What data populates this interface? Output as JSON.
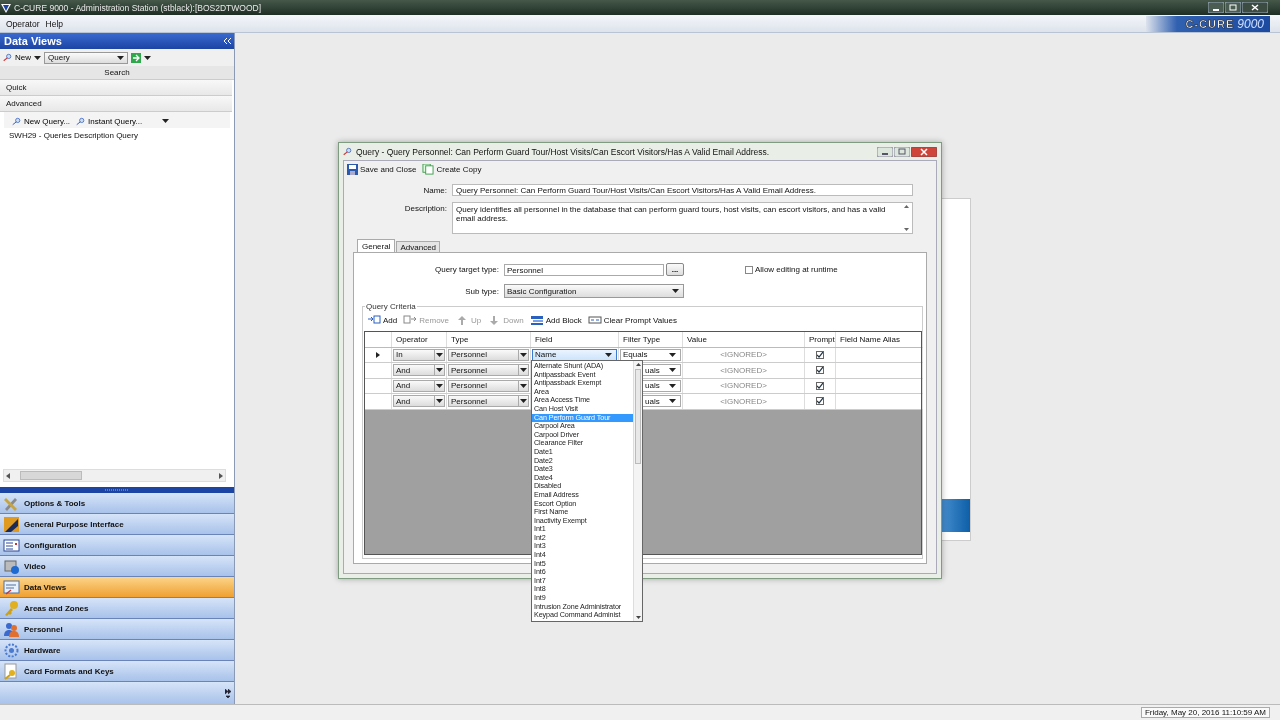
{
  "app_window": {
    "title": "C-CURE 9000 - Administration Station (stblack):[BOS2DTWOOD]",
    "menu": [
      "Operator",
      "Help"
    ],
    "logo": {
      "brand": "C-CURE",
      "version": "9000"
    }
  },
  "sidebar": {
    "title": "Data Views",
    "new_label": "New",
    "view_select": "Query",
    "search_header": "Search",
    "sections": [
      "Quick",
      "Advanced"
    ],
    "list_toolbar": [
      "New Query...",
      "Instant Query..."
    ],
    "items": [
      "SWH29 - Queries Description Query"
    ],
    "nav": [
      {
        "label": "Options & Tools",
        "selected": false
      },
      {
        "label": "General Purpose Interface",
        "selected": false
      },
      {
        "label": "Configuration",
        "selected": false
      },
      {
        "label": "Video",
        "selected": false
      },
      {
        "label": "Data Views",
        "selected": true
      },
      {
        "label": "Areas and Zones",
        "selected": false
      },
      {
        "label": "Personnel",
        "selected": false
      },
      {
        "label": "Hardware",
        "selected": false
      },
      {
        "label": "Card Formats and Keys",
        "selected": false
      }
    ]
  },
  "dialog": {
    "title": "Query  -  Query Personnel: Can Perform Guard Tour/Host Visits/Can Escort Visitors/Has A Valid Email Address.",
    "toolbar": [
      "Save and Close",
      "Create Copy"
    ],
    "name": {
      "label": "Name:",
      "value": "Query Personnel: Can Perform Guard Tour/Host Visits/Can Escort Visitors/Has A Valid Email Address."
    },
    "description": {
      "label": "Description:",
      "value": "Query identifies all personnel in the database that can perform guard tours, host visits, can escort visitors, and has a valid email address."
    },
    "tabs": [
      {
        "label": "General",
        "selected": true
      },
      {
        "label": "Advanced",
        "selected": false
      }
    ],
    "target_type": {
      "label": "Query target type:",
      "value": "Personnel",
      "button": "..."
    },
    "allow_editing": {
      "label": "Allow editing at runtime",
      "checked": false
    },
    "sub_type": {
      "label": "Sub type:",
      "value": "Basic Configuration"
    },
    "criteria": {
      "title": "Query Criteria",
      "toolbar": [
        {
          "label": "Add",
          "disabled": false
        },
        {
          "label": "Remove",
          "disabled": true
        },
        {
          "label": "Up",
          "disabled": true
        },
        {
          "label": "Down",
          "disabled": true
        },
        {
          "label": "Add Block",
          "disabled": false
        },
        {
          "label": "Clear Prompt Values",
          "disabled": false
        }
      ],
      "columns": [
        "Operator",
        "Type",
        "Field",
        "Filter Type",
        "Value",
        "Prompt",
        "Field Name Alias"
      ],
      "rows": [
        {
          "current": true,
          "operator": "In",
          "type": "Personnel",
          "field": "Name",
          "filter_type": "Equals",
          "value": "<IGNORED>",
          "prompt": true
        },
        {
          "current": false,
          "operator": "And",
          "type": "Personnel",
          "filter_type": "uals",
          "value": "<IGNORED>",
          "prompt": true
        },
        {
          "current": false,
          "operator": "And",
          "type": "Personnel",
          "filter_type": "uals",
          "value": "<IGNORED>",
          "prompt": true
        },
        {
          "current": false,
          "operator": "And",
          "type": "Personnel",
          "filter_type": "uals",
          "value": "<IGNORED>",
          "prompt": true
        }
      ],
      "field_dropdown": [
        {
          "label": "Alternate Shunt (ADA)",
          "selected": false
        },
        {
          "label": "Antipassback Event",
          "selected": false
        },
        {
          "label": "Antipassback Exempt",
          "selected": false
        },
        {
          "label": "Area",
          "selected": false
        },
        {
          "label": "Area Access Time",
          "selected": false
        },
        {
          "label": "Can Host Visit",
          "selected": false
        },
        {
          "label": "Can Perform Guard Tour",
          "selected": true
        },
        {
          "label": "Carpool Area",
          "selected": false
        },
        {
          "label": "Carpool Driver",
          "selected": false
        },
        {
          "label": "Clearance Filter",
          "selected": false
        },
        {
          "label": "Date1",
          "selected": false
        },
        {
          "label": "Date2",
          "selected": false
        },
        {
          "label": "Date3",
          "selected": false
        },
        {
          "label": "Date4",
          "selected": false
        },
        {
          "label": "Disabled",
          "selected": false
        },
        {
          "label": "Email Address",
          "selected": false
        },
        {
          "label": "Escort Option",
          "selected": false
        },
        {
          "label": "First Name",
          "selected": false
        },
        {
          "label": "Inactivity Exempt",
          "selected": false
        },
        {
          "label": "Int1",
          "selected": false
        },
        {
          "label": "Int2",
          "selected": false
        },
        {
          "label": "Int3",
          "selected": false
        },
        {
          "label": "Int4",
          "selected": false
        },
        {
          "label": "Int5",
          "selected": false
        },
        {
          "label": "Int6",
          "selected": false
        },
        {
          "label": "Int7",
          "selected": false
        },
        {
          "label": "Int8",
          "selected": false
        },
        {
          "label": "Int9",
          "selected": false
        },
        {
          "label": "Intrusion Zone Administrator",
          "selected": false
        },
        {
          "label": "Keypad Command Administ",
          "selected": false
        }
      ]
    }
  },
  "status_bar": {
    "datetime": "Friday, May 20, 2016 11:10:59 AM"
  }
}
